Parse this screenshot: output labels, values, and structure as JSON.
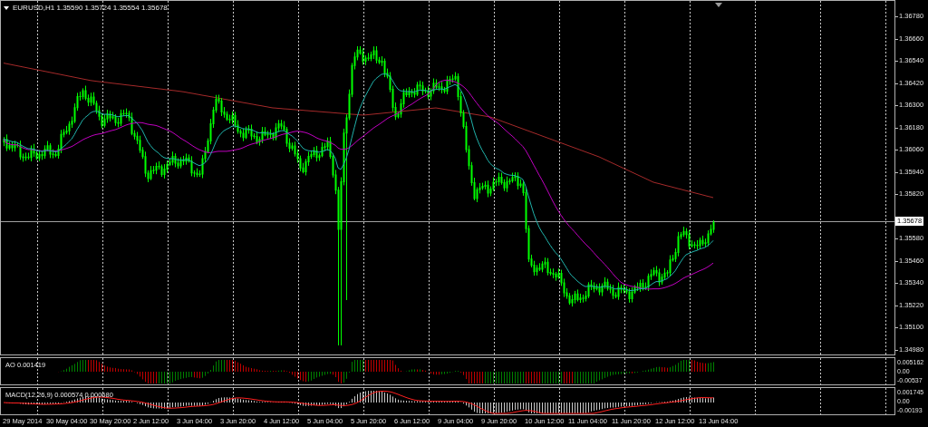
{
  "chart_title": "EURUSD,H1 1.35590 1.35724 1.35554 1.35678",
  "price_axis": {
    "labels": [
      "1.36780",
      "1.36660",
      "1.36540",
      "1.36420",
      "1.36300",
      "1.36180",
      "1.36060",
      "1.35940",
      "1.35820",
      "1.35580",
      "1.35460",
      "1.35340",
      "1.35220",
      "1.35100",
      "1.34980"
    ],
    "current_price": "1.35678"
  },
  "indicators": [
    {
      "kind": "ao",
      "label": "AO 0.001419",
      "scale": [
        "0.005162",
        "0.00",
        "-0.00537"
      ]
    },
    {
      "kind": "macd",
      "label": "MACD(12,26,9) 0.000574 0.000680",
      "scale": [
        "0.001745",
        "0.00",
        "-0.00193"
      ]
    }
  ],
  "time_axis": {
    "labels": [
      "29 May 2014",
      "30 May 04:00",
      "30 May 20:00",
      "2 Jun 12:00",
      "3 Jun 04:00",
      "3 Jun 20:00",
      "4 Jun 12:00",
      "5 Jun 04:00",
      "5 Jun 20:00",
      "6 Jun 12:00",
      "9 Jun 04:00",
      "9 Jun 20:00",
      "10 Jun 12:00",
      "11 Jun 04:00",
      "11 Jun 20:00",
      "12 Jun 12:00",
      "13 Jun 04:00"
    ]
  }
}
